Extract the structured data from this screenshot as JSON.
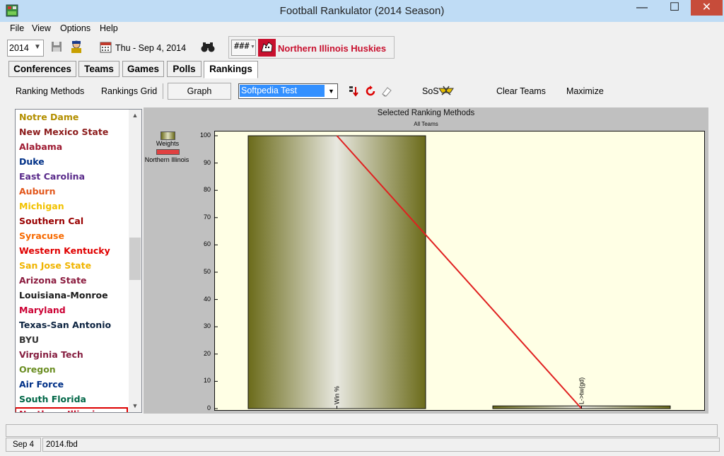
{
  "window": {
    "title": "Football Rankulator  (2014 Season)",
    "minimize": "—",
    "maximize": "☐",
    "close": "✕"
  },
  "menu": {
    "file": "File",
    "view": "View",
    "options": "Options",
    "help": "Help"
  },
  "toolbar": {
    "season": "2014",
    "date": "Thu - Sep 4, 2014",
    "team_selector_value": "###",
    "team_name": "Northern Illinois Huskies"
  },
  "tabs": [
    "Conferences",
    "Teams",
    "Games",
    "Polls",
    "Rankings"
  ],
  "subtoolbar": {
    "ranking_methods": "Ranking Methods",
    "rankings_grid": "Rankings Grid",
    "graph": "Graph",
    "method_selected": "Softpedia Test",
    "sos": "SoS",
    "clear_teams": "Clear Teams",
    "maximize": "Maximize"
  },
  "team_list": {
    "items": [
      {
        "name": "Notre Dame",
        "color": "#b38f00"
      },
      {
        "name": "New Mexico State",
        "color": "#8b1a1a"
      },
      {
        "name": "Alabama",
        "color": "#9e1b32"
      },
      {
        "name": "Duke",
        "color": "#003087"
      },
      {
        "name": "East Carolina",
        "color": "#592a8a"
      },
      {
        "name": "Auburn",
        "color": "#e2561b"
      },
      {
        "name": "Michigan",
        "color": "#f2c200"
      },
      {
        "name": "Southern Cal",
        "color": "#990000"
      },
      {
        "name": "Syracuse",
        "color": "#f76900"
      },
      {
        "name": "Western Kentucky",
        "color": "#e00000"
      },
      {
        "name": "San Jose State",
        "color": "#f0b400"
      },
      {
        "name": "Arizona State",
        "color": "#8c1d40"
      },
      {
        "name": "Louisiana-Monroe",
        "color": "#1a1a1a"
      },
      {
        "name": "Maryland",
        "color": "#cc0033"
      },
      {
        "name": "Texas-San Antonio",
        "color": "#0c2340"
      },
      {
        "name": "BYU",
        "color": "#333333"
      },
      {
        "name": "Virginia Tech",
        "color": "#861f41"
      },
      {
        "name": "Oregon",
        "color": "#6b8e23"
      },
      {
        "name": "Air Force",
        "color": "#003087"
      },
      {
        "name": "South Florida",
        "color": "#006747"
      },
      {
        "name": "Northern Illinois",
        "color": "#c8102e"
      }
    ]
  },
  "chart_data": {
    "type": "bar",
    "title": "Selected Ranking Methods",
    "subtitle": "All Teams",
    "categories": [
      "Win %",
      "L->tw(gd)"
    ],
    "ylim": [
      0,
      100
    ],
    "yticks": [
      0,
      10,
      20,
      30,
      40,
      50,
      60,
      70,
      80,
      90,
      100
    ],
    "series": [
      {
        "name": "Weights",
        "type": "bar",
        "values": [
          100,
          1
        ],
        "color": "#6b6b1a"
      },
      {
        "name": "Northern Illinois",
        "type": "line",
        "values": [
          100,
          0
        ],
        "color": "#e02020"
      }
    ],
    "legend": "top-left"
  },
  "status": {
    "date": "Sep 4",
    "file": "2014.fbd"
  }
}
